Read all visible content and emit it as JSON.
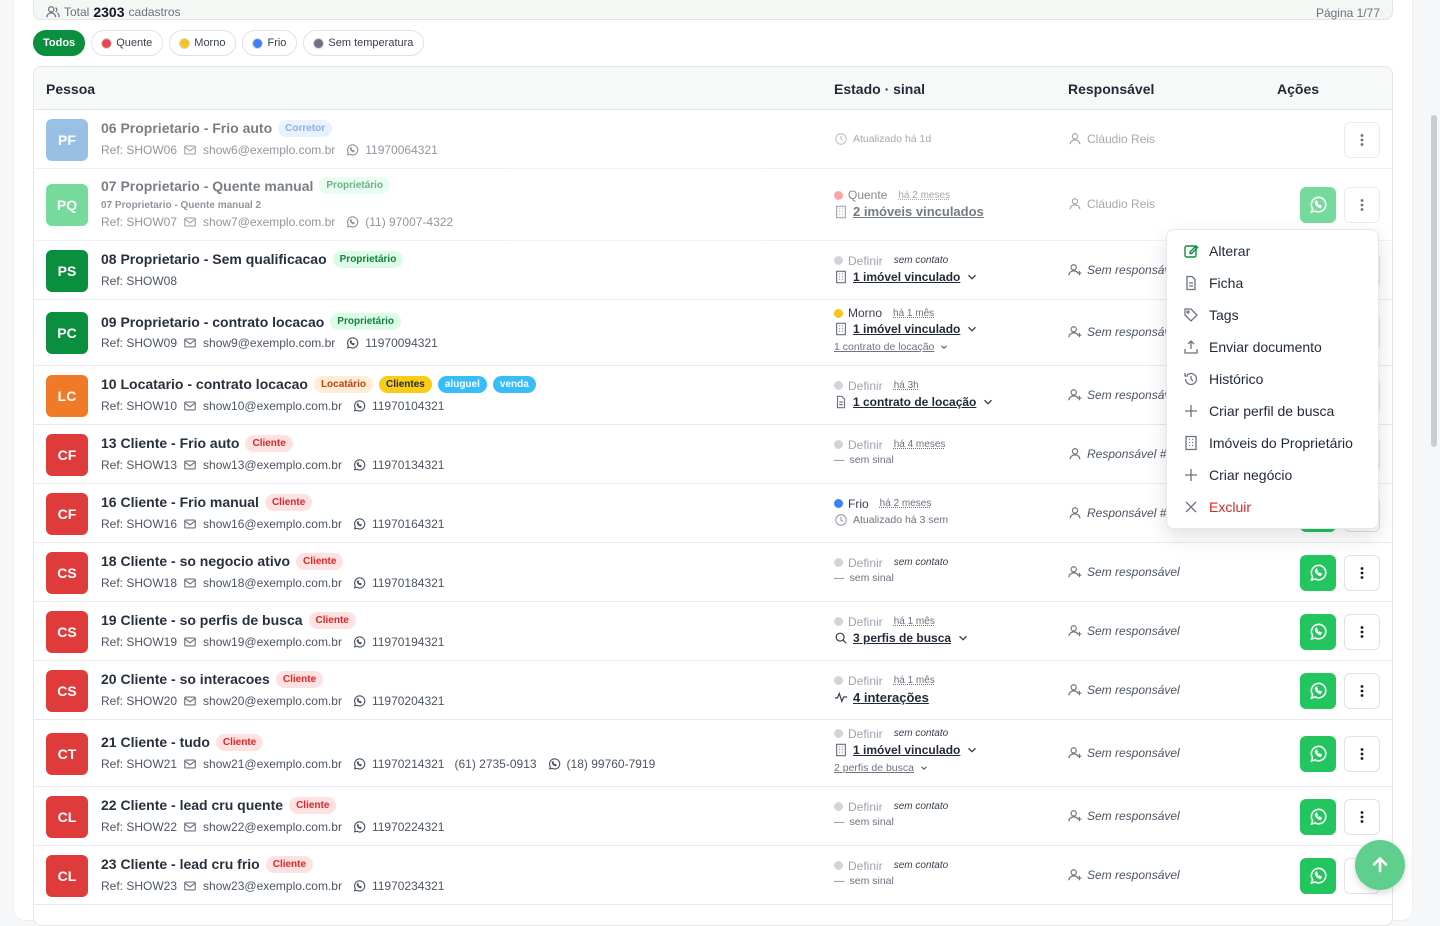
{
  "summary": {
    "total_prefix": "Total",
    "total_count": "2303",
    "total_suffix": "cadastros",
    "page": "Página 1/77"
  },
  "filters": [
    {
      "label": "Todos",
      "active": true
    },
    {
      "label": "Quente",
      "color": "#e5484d"
    },
    {
      "label": "Morno",
      "color": "#f5c518"
    },
    {
      "label": "Frio",
      "color": "#3b82f6"
    },
    {
      "label": "Sem temperatura",
      "color": "#6b7280"
    }
  ],
  "columns": {
    "pessoa": "Pessoa",
    "estado": "Estado · sinal",
    "responsavel": "Responsável",
    "acoes": "Ações"
  },
  "rows": [
    {
      "initials": "PF",
      "name": "06 Proprietario - Frio auto",
      "tags": [
        "Corretor"
      ],
      "ref": "Ref: SHOW06",
      "email": "show6@exemplo.com.br",
      "phones": [
        "11970064321"
      ],
      "status": {
        "line1": "Atualizado há 1d"
      },
      "resp": "Cláudio Reis"
    },
    {
      "initials": "PQ",
      "name": "07 Proprietario - Quente manual",
      "tags": [
        "Proprietário"
      ],
      "subname": "07 Proprietario - Quente manual 2",
      "ref": "Ref: SHOW07",
      "email": "show7@exemplo.com.br",
      "phones": [
        "(11) 97007-4322"
      ],
      "status": {
        "temp": "Quente",
        "ago": "há 2 meses",
        "line2": "2 imóveis vinculados"
      },
      "resp": "Cláudio Reis"
    },
    {
      "initials": "PS",
      "name": "08 Proprietario - Sem qualificacao",
      "tags": [
        "Proprietário"
      ],
      "ref": "Ref: SHOW08",
      "status": {
        "temp": "Definir",
        "ago": "sem contato",
        "line2": "1 imóvel vinculado"
      },
      "resp": "Sem responsável"
    },
    {
      "initials": "PC",
      "name": "09 Proprietario - contrato locacao",
      "tags": [
        "Proprietário"
      ],
      "ref": "Ref: SHOW09",
      "email": "show9@exemplo.com.br",
      "phones": [
        "11970094321"
      ],
      "status": {
        "temp": "Morno",
        "ago": "há 1 mês",
        "line2": "1 imóvel vinculado",
        "line3": "1 contrato de locação"
      },
      "resp": "Sem responsável"
    },
    {
      "initials": "LC",
      "name": "10 Locatario - contrato locacao",
      "tags": [
        "Locatário",
        "Clientes",
        "aluguel",
        "venda"
      ],
      "ref": "Ref: SHOW10",
      "email": "show10@exemplo.com.br",
      "phones": [
        "11970104321"
      ],
      "status": {
        "temp": "Definir",
        "ago": "há 3h",
        "line2": "1 contrato de locação"
      },
      "resp": "Sem responsável"
    },
    {
      "initials": "CF",
      "name": "13 Cliente - Frio auto",
      "tags": [
        "Cliente"
      ],
      "ref": "Ref: SHOW13",
      "email": "show13@exemplo.com.br",
      "phones": [
        "11970134321"
      ],
      "status": {
        "temp": "Definir",
        "ago": "há 4 meses",
        "line2": "sem sinal"
      },
      "resp": "Responsável #"
    },
    {
      "initials": "CF",
      "name": "16 Cliente - Frio manual",
      "tags": [
        "Cliente"
      ],
      "ref": "Ref: SHOW16",
      "email": "show16@exemplo.com.br",
      "phones": [
        "11970164321"
      ],
      "status": {
        "temp": "Frio",
        "ago": "há 2 meses",
        "line2": "Atualizado há 3 sem"
      },
      "resp": "Responsável #"
    },
    {
      "initials": "CS",
      "name": "18 Cliente - so negocio ativo",
      "tags": [
        "Cliente"
      ],
      "ref": "Ref: SHOW18",
      "email": "show18@exemplo.com.br",
      "phones": [
        "11970184321"
      ],
      "status": {
        "temp": "Definir",
        "ago": "sem contato",
        "line2": "sem sinal"
      },
      "resp": "Sem responsável"
    },
    {
      "initials": "CS",
      "name": "19 Cliente - so perfis de busca",
      "tags": [
        "Cliente"
      ],
      "ref": "Ref: SHOW19",
      "email": "show19@exemplo.com.br",
      "phones": [
        "11970194321"
      ],
      "status": {
        "temp": "Definir",
        "ago": "há 1 mês",
        "line2": "3 perfis de busca"
      },
      "resp": "Sem responsável"
    },
    {
      "initials": "CS",
      "name": "20 Cliente - so interacoes",
      "tags": [
        "Cliente"
      ],
      "ref": "Ref: SHOW20",
      "email": "show20@exemplo.com.br",
      "phones": [
        "11970204321"
      ],
      "status": {
        "temp": "Definir",
        "ago": "há 1 mês",
        "line2": "4 interações"
      },
      "resp": "Sem responsável"
    },
    {
      "initials": "CT",
      "name": "21 Cliente - tudo",
      "tags": [
        "Cliente"
      ],
      "ref": "Ref: SHOW21",
      "email": "show21@exemplo.com.br",
      "phones": [
        "11970214321",
        "(61) 2735-0913",
        "(18) 99760-7919"
      ],
      "status": {
        "temp": "Definir",
        "ago": "sem contato",
        "line2": "1 imóvel vinculado",
        "line3": "2 perfis de busca"
      },
      "resp": "Sem responsável"
    },
    {
      "initials": "CL",
      "name": "22 Cliente - lead cru quente",
      "tags": [
        "Cliente"
      ],
      "ref": "Ref: SHOW22",
      "email": "show22@exemplo.com.br",
      "phones": [
        "11970224321"
      ],
      "status": {
        "temp": "Definir",
        "ago": "sem contato",
        "line2": "sem sinal"
      },
      "resp": "Sem responsável"
    },
    {
      "initials": "CL",
      "name": "23 Cliente - lead cru frio",
      "tags": [
        "Cliente"
      ],
      "ref": "Ref: SHOW23",
      "email": "show23@exemplo.com.br",
      "phones": [
        "11970234321"
      ],
      "status": {
        "temp": "Definir",
        "ago": "sem contato",
        "line2": "sem sinal"
      },
      "resp": "Sem responsável"
    }
  ],
  "menu": [
    "Alterar",
    "Ficha",
    "Tags",
    "Enviar documento",
    "Histórico",
    "Criar perfil de busca",
    "Imóveis do Proprietário",
    "Criar negócio",
    "Excluir"
  ],
  "colors": {
    "primary": "#0a8f3e",
    "whatsapp": "#22c55e",
    "danger": "#dc2626"
  }
}
